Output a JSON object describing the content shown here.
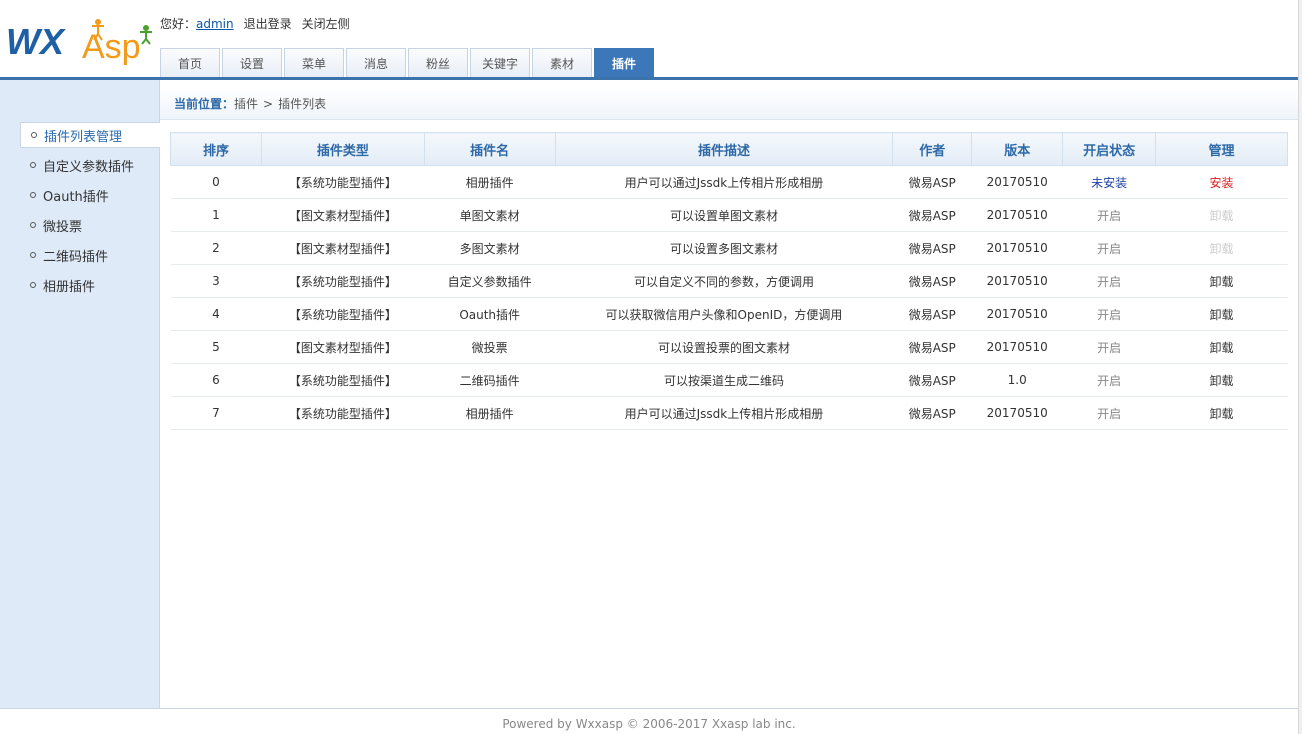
{
  "logo": {
    "text_main": "WX",
    "text_sub": "Asp",
    "primary_color": "#1f5fa6",
    "accent_color": "#f29a1a"
  },
  "userbar": {
    "greeting": "您好：",
    "username": "admin",
    "logout": "退出登录",
    "close_left": "关闭左侧"
  },
  "tabs": [
    {
      "label": "首页"
    },
    {
      "label": "设置"
    },
    {
      "label": "菜单"
    },
    {
      "label": "消息"
    },
    {
      "label": "粉丝"
    },
    {
      "label": "关键字"
    },
    {
      "label": "素材"
    },
    {
      "label": "插件",
      "active": true
    }
  ],
  "sidebar": {
    "items": [
      {
        "label": "插件列表管理",
        "active": true
      },
      {
        "label": "自定义参数插件"
      },
      {
        "label": "Oauth插件"
      },
      {
        "label": "微投票"
      },
      {
        "label": "二维码插件"
      },
      {
        "label": "相册插件"
      }
    ]
  },
  "breadcrumb": {
    "label": "当前位置：",
    "path1": "插件",
    "sep": ">",
    "path2": "插件列表"
  },
  "table": {
    "headers": [
      "排序",
      "插件类型",
      "插件名",
      "插件描述",
      "作者",
      "版本",
      "开启状态",
      "管理"
    ],
    "rows": [
      {
        "order": "0",
        "type": "【系统功能型插件】",
        "name": "相册插件",
        "desc": "用户可以通过Jssdk上传相片形成相册",
        "author": "微易ASP",
        "version": "20170510",
        "status": "未安装",
        "action": "安装",
        "status_style": "blue",
        "action_style": "red"
      },
      {
        "order": "1",
        "type": "【图文素材型插件】",
        "name": "单图文素材",
        "desc": "可以设置单图文素材",
        "author": "微易ASP",
        "version": "20170510",
        "status": "开启",
        "action": "卸载",
        "status_style": "muted",
        "action_style": "faint"
      },
      {
        "order": "2",
        "type": "【图文素材型插件】",
        "name": "多图文素材",
        "desc": "可以设置多图文素材",
        "author": "微易ASP",
        "version": "20170510",
        "status": "开启",
        "action": "卸载",
        "status_style": "muted",
        "action_style": "faint"
      },
      {
        "order": "3",
        "type": "【系统功能型插件】",
        "name": "自定义参数插件",
        "desc": "可以自定义不同的参数，方便调用",
        "author": "微易ASP",
        "version": "20170510",
        "status": "开启",
        "action": "卸载",
        "status_style": "muted",
        "action_style": ""
      },
      {
        "order": "4",
        "type": "【系统功能型插件】",
        "name": "Oauth插件",
        "desc": "可以获取微信用户头像和OpenID，方便调用",
        "author": "微易ASP",
        "version": "20170510",
        "status": "开启",
        "action": "卸载",
        "status_style": "muted",
        "action_style": ""
      },
      {
        "order": "5",
        "type": "【图文素材型插件】",
        "name": "微投票",
        "desc": "可以设置投票的图文素材",
        "author": "微易ASP",
        "version": "20170510",
        "status": "开启",
        "action": "卸载",
        "status_style": "muted",
        "action_style": ""
      },
      {
        "order": "6",
        "type": "【系统功能型插件】",
        "name": "二维码插件",
        "desc": "可以按渠道生成二维码",
        "author": "微易ASP",
        "version": "1.0",
        "status": "开启",
        "action": "卸载",
        "status_style": "muted",
        "action_style": ""
      },
      {
        "order": "7",
        "type": "【系统功能型插件】",
        "name": "相册插件",
        "desc": "用户可以通过Jssdk上传相片形成相册",
        "author": "微易ASP",
        "version": "20170510",
        "status": "开启",
        "action": "卸载",
        "status_style": "muted",
        "action_style": ""
      }
    ]
  },
  "footer": {
    "text": "Powered by Wxxasp © 2006-2017 Xxasp lab inc."
  }
}
